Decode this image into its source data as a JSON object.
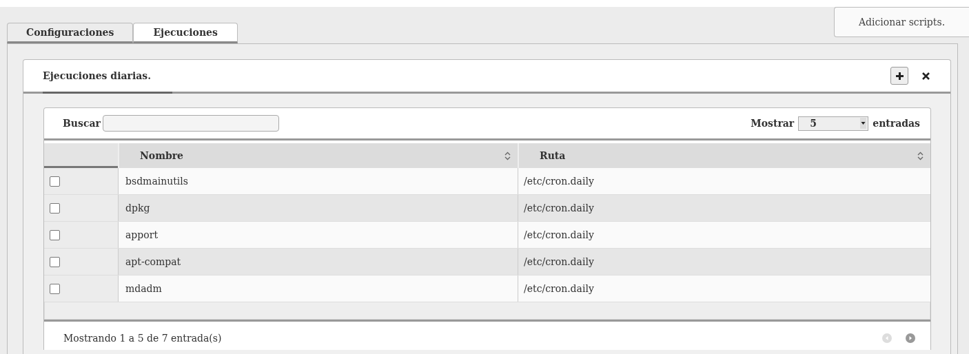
{
  "tabs": [
    {
      "label": "Configuraciones",
      "selected": false
    },
    {
      "label": "Ejecuciones",
      "selected": true
    }
  ],
  "add_scripts_button": "Adicionar scripts.",
  "panel": {
    "title": "Ejecuciones diarias.",
    "search": {
      "label": "Buscar"
    },
    "show": {
      "label": "Mostrar",
      "value": "5",
      "suffix": "entradas"
    },
    "table": {
      "columns": [
        "Nombre",
        "Ruta"
      ],
      "rows": [
        {
          "checked": false,
          "name": "bsdmainutils",
          "path": "/etc/cron.daily"
        },
        {
          "checked": false,
          "name": "dpkg",
          "path": "/etc/cron.daily"
        },
        {
          "checked": false,
          "name": "apport",
          "path": "/etc/cron.daily"
        },
        {
          "checked": false,
          "name": "apt-compat",
          "path": "/etc/cron.daily"
        },
        {
          "checked": false,
          "name": "mdadm",
          "path": "/etc/cron.daily"
        }
      ]
    },
    "footer": "Mostrando 1 a 5 de 7 entrada(s)",
    "pager": {
      "previous_disabled": true,
      "next_disabled": false
    }
  }
}
